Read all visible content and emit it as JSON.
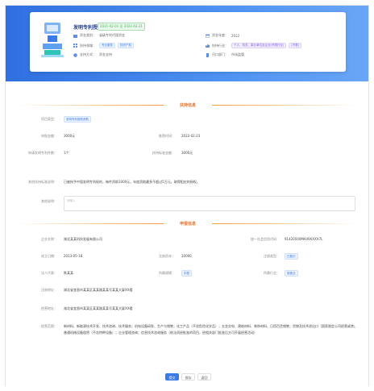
{
  "header": {
    "title": "发明专利授权资助",
    "date_badge": "2021-02-01 至 2022-02-21",
    "items": [
      {
        "label": "资金类别：",
        "value": "省级专利代理资金"
      },
      {
        "label": "扶持领域：",
        "tags": [
          "专业服务",
          "知识产权"
        ]
      },
      {
        "label": "支持方式：",
        "value": "资金支持"
      },
      {
        "label": "资金年度：",
        "value": "2022"
      },
      {
        "label": "扶持行业：",
        "tags": [
          "个人、机关、事业单位及企业(不限行业)",
          "(不限)"
        ]
      },
      {
        "label": "归口部门：",
        "value": "市场监管"
      }
    ]
  },
  "sections": {
    "project": "扶持信息",
    "applicant": "申报信息"
  },
  "project": {
    "type_label": "项目类型：",
    "type_value": "发明专利授权资助",
    "amount_label": "申报金额：",
    "amount_value": "3000元",
    "date_label": "推荐时间：",
    "date_value": "2022-02-23",
    "count_label": "申请发明专利件数：",
    "count_value": "1个",
    "support_label": "扶持标准金额：",
    "support_value": "3000元",
    "std_label": "其他扶持标准说明：",
    "std_value": "已被授予中国发明专利权的，每件资助1000元，年度资助最多不超过5万元，取得相应的授权。",
    "remark_label": "其他说明：",
    "remark_placeholder": "请输入"
  },
  "applicant": {
    "name_label": "企业名称：",
    "name_value": "湖北某某科技发展有限公司",
    "credit_label": "统一社会信用代码：",
    "credit_value": "91420500MA49XXXX7L",
    "found_label": "成立日期：",
    "found_value": "2013-05-18",
    "capital_label": "注册资本：",
    "capital_value": "10000",
    "status_label": "注册类型：",
    "status_value": "已登记",
    "legal_label": "法人代表：",
    "legal_value": "陈某某",
    "scale_label": "所属规模：",
    "scale_value": "中型",
    "ind_label": "所属行业：",
    "ind_value": "制造业",
    "addr_label": "注册地址：",
    "addr_value": "湖北省宜昌市某某区某某路某某号某某大厦XX楼",
    "oaddr_label": "经营地址：",
    "oaddr_value": "湖北省宜昌市某某区某某路某某号某某大厦XX楼",
    "scope_label": "经营范围：",
    "scope_line1": "新材料、新能源技术开发、技术咨询、技术服务；机电设备研发、生产与销售；化工产品（不含危险化学品）；五金交电、建筑材料、装饰材料、日用百货销售；货物及技术进出口（国家限定公司经营或禁止进出口的商品及技术除外）；",
    "scope_line2": "普通机械设备租赁（不含特种设备）；企业管理咨询；信息技术咨询服务（依法须经批准的项目，经相关部门批准后方可开展经营活动）"
  },
  "buttons": {
    "submit": "提交",
    "save": "保存",
    "back": "返回"
  }
}
